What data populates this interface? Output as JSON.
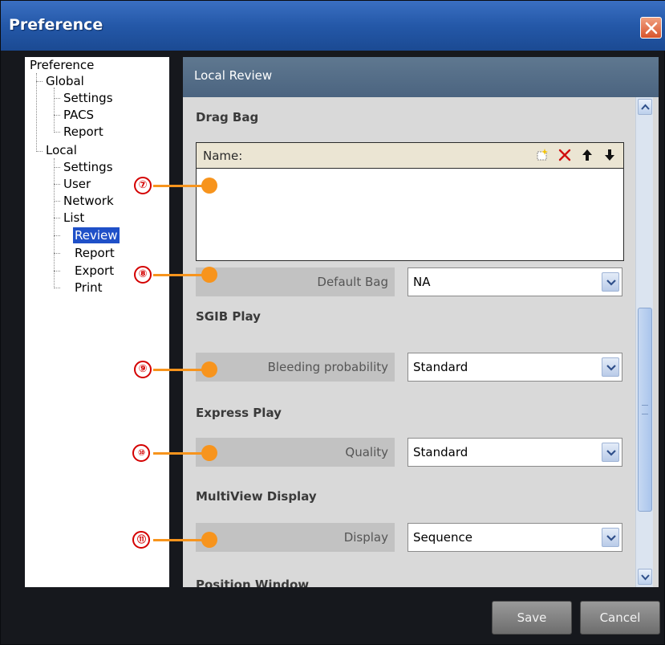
{
  "window": {
    "title": "Preference"
  },
  "tree": {
    "root": "Preference",
    "groups": [
      {
        "label": "Global",
        "children": [
          "Settings",
          "PACS",
          "Report"
        ]
      },
      {
        "label": "Local",
        "children": [
          "Settings",
          "User",
          "Network",
          "List",
          "Review",
          "Report",
          "Export",
          "Print"
        ]
      }
    ],
    "selected": "Review"
  },
  "panel": {
    "title": "Local Review",
    "drag_bag": {
      "section": "Drag Bag",
      "name_label": "Name:",
      "default_bag_label": "Default Bag",
      "default_bag_value": "NA"
    },
    "sgib_play": {
      "section": "SGIB Play",
      "label": "Bleeding probability",
      "value": "Standard"
    },
    "express_play": {
      "section": "Express Play",
      "label": "Quality",
      "value": "Standard"
    },
    "multiview": {
      "section": "MultiView Display",
      "label": "Display",
      "value": "Sequence"
    },
    "position_window": {
      "section": "Position Window"
    }
  },
  "annotations": [
    "⑦",
    "⑧",
    "⑨",
    "⑩",
    "⑪"
  ],
  "footer": {
    "save_label": "Save",
    "cancel_label": "Cancel"
  },
  "colors": {
    "titlebar": "#2458a8",
    "panel_header": "#5a7389",
    "selected": "#1f50c8",
    "annotation_dot": "#f7941d",
    "annotation_ring": "#d40000"
  }
}
